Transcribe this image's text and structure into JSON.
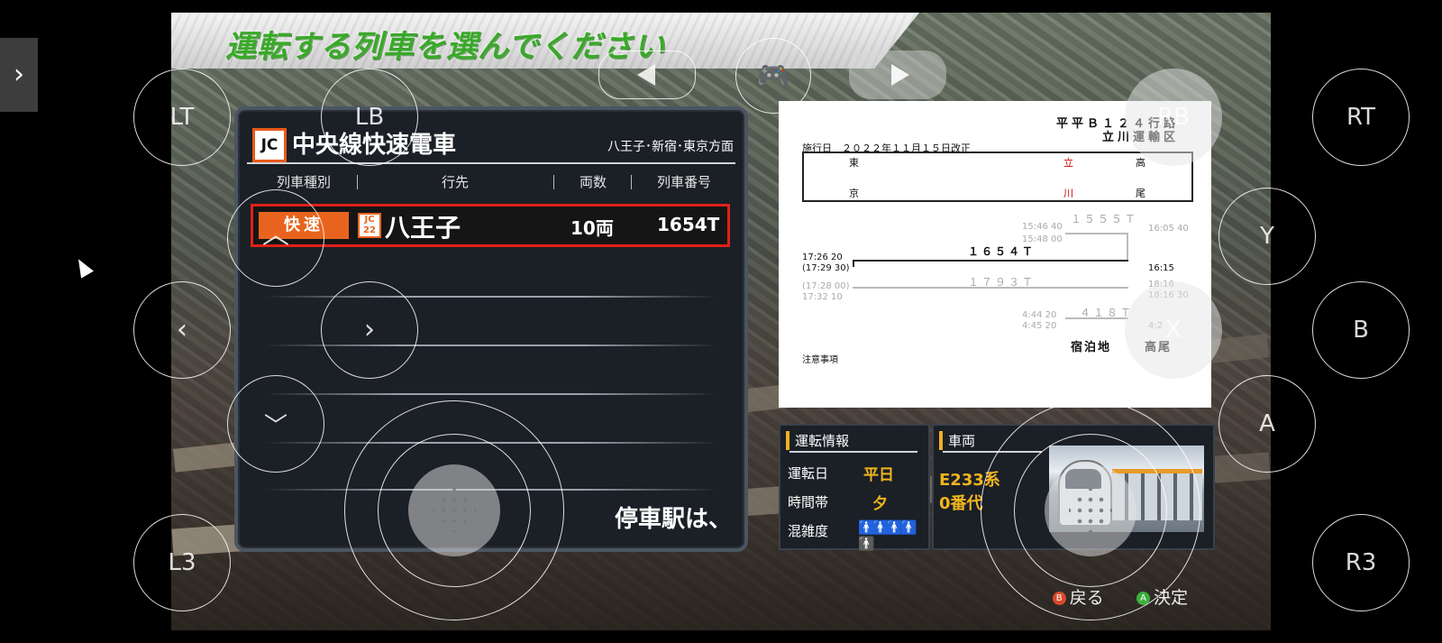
{
  "screen_title": "運転する列車を選んでください",
  "train_list": {
    "line_code": "JC",
    "line_name": "中央線快速電車",
    "direction": "八王子･新宿･東京方面",
    "columns": [
      "列車種別",
      "行先",
      "両数",
      "列車番号"
    ],
    "selected_train": {
      "type": "快速",
      "station_number": "JC 22",
      "destination": "八王子",
      "cars": "10両",
      "train_number": "1654T"
    },
    "stops_text": "停車駅は、"
  },
  "diagram": {
    "header_right": "平平Ｂ１２４行路",
    "office": "立川運輸区",
    "revision": "施行日　２０２２年１１月１５日改正",
    "stations_top": [
      "東",
      "立",
      "高"
    ],
    "stations_bottom": [
      "京",
      "川",
      "尾"
    ],
    "trains": [
      {
        "number": "１５５５Ｔ",
        "times": [
          "15:46 40",
          "15:48 00",
          "16:05 40"
        ]
      },
      {
        "number": "１６５４Ｔ",
        "times": [
          "17:26 20",
          "(17:29 30)",
          "16:15"
        ]
      },
      {
        "number": "１７９３Ｔ",
        "times": [
          "(17:28 00)",
          "17:32 10",
          "18:16",
          "18:16 30"
        ]
      },
      {
        "number": "４１８Ｔ",
        "times": [
          "4:44 20",
          "4:45 20",
          "4:2"
        ]
      }
    ],
    "lodging_label": "宿泊地",
    "lodging_place": "高尾",
    "notes_label": "注意事項"
  },
  "operation_info": {
    "title": "運転情報",
    "rows": [
      {
        "label": "運転日",
        "value": "平日"
      },
      {
        "label": "時間帯",
        "value": "夕"
      },
      {
        "label": "混雑度",
        "value": "👥"
      }
    ],
    "congestion_level": 4,
    "congestion_max": 5
  },
  "vehicle": {
    "title": "車両",
    "name_line1": "E233系",
    "name_line2": "0番代"
  },
  "footer": {
    "back_label": "戻る",
    "confirm_label": "決定",
    "back_button_glyph": "B",
    "confirm_button_glyph": "A"
  },
  "overlay": {
    "lt": "LT",
    "lb": "LB",
    "rb": "RB",
    "rt": "RT",
    "y": "Y",
    "x": "X",
    "b": "B",
    "a": "A",
    "l3": "L3",
    "r3": "R3"
  },
  "colors": {
    "accent_orange": "#e8641e",
    "title_green": "#3aa82a",
    "highlight_red": "#e0201a",
    "value_yellow": "#f2b51c"
  }
}
